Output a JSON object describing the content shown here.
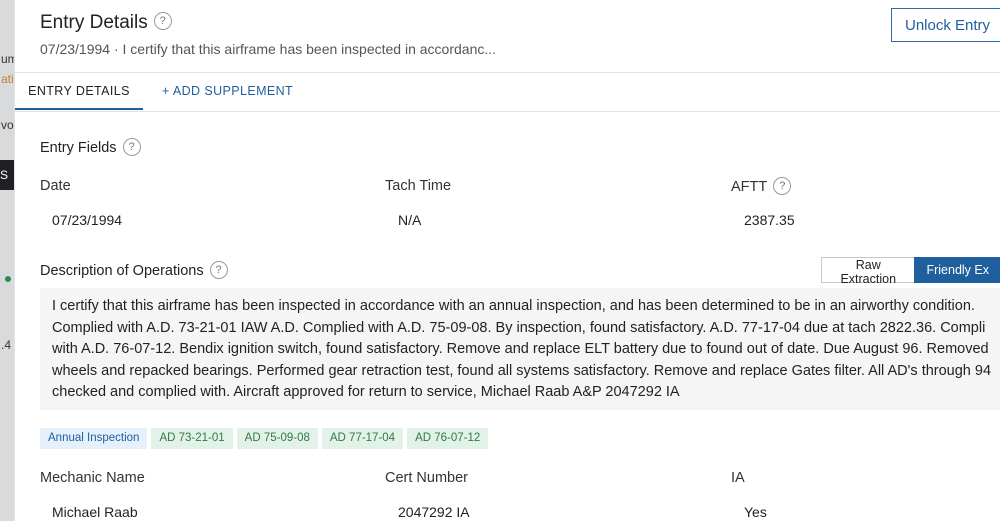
{
  "background": {
    "fragments": [
      "um",
      "ati",
      "vo",
      "S",
      ".4"
    ]
  },
  "header": {
    "title": "Entry Details",
    "subtitle": "07/23/1994 · I certify that this airframe has been inspected in accordanc...",
    "unlock_label": "Unlock Entry",
    "help_glyph": "?"
  },
  "tabs": [
    {
      "label": "ENTRY DETAILS",
      "active": true
    },
    {
      "label": "+ ADD SUPPLEMENT",
      "active": false
    }
  ],
  "entry_fields": {
    "title": "Entry Fields",
    "date_label": "Date",
    "date_value": "07/23/1994",
    "tach_label": "Tach Time",
    "tach_value": "N/A",
    "aftt_label": "AFTT",
    "aftt_value": "2387.35"
  },
  "description": {
    "title": "Description of Operations",
    "raw_label": "Raw Extraction",
    "friendly_label": "Friendly Ex",
    "lines": [
      "I certify that this airframe has been inspected in accordance with an annual inspection, and has been determined to be in an airworthy condition.",
      "Complied with A.D. 73-21-01 IAW A.D. Complied with A.D. 75-09-08. By inspection, found satisfactory. A.D. 77-17-04 due at tach 2822.36. Compli",
      "with A.D. 76-07-12. Bendix ignition switch, found satisfactory. Remove and replace ELT battery due to found out of date. Due August 96. Removed",
      "wheels and repacked bearings. Performed gear retraction test, found all systems satisfactory. Remove and replace Gates filter. All AD's through 94",
      "checked and complied with. Aircraft approved for return to service, Michael Raab A&P 2047292 IA"
    ]
  },
  "tags": [
    {
      "label": "Annual Inspection",
      "color": "#1f5f9e",
      "kind": "blue"
    },
    {
      "label": "AD 73-21-01",
      "color": "#2f7a47",
      "kind": "green"
    },
    {
      "label": "AD 75-09-08",
      "color": "#2f7a47",
      "kind": "green"
    },
    {
      "label": "AD 77-17-04",
      "color": "#2f7a47",
      "kind": "green"
    },
    {
      "label": "AD 76-07-12",
      "color": "#2f7a47",
      "kind": "green"
    }
  ],
  "mechanic": {
    "name_label": "Mechanic Name",
    "name_value": "Michael Raab",
    "cert_label": "Cert Number",
    "cert_value": "2047292 IA",
    "ia_label": "IA",
    "ia_value": "Yes"
  },
  "colors": {
    "accent": "#1f5f9e",
    "description_bg": "#f5f5f5"
  }
}
